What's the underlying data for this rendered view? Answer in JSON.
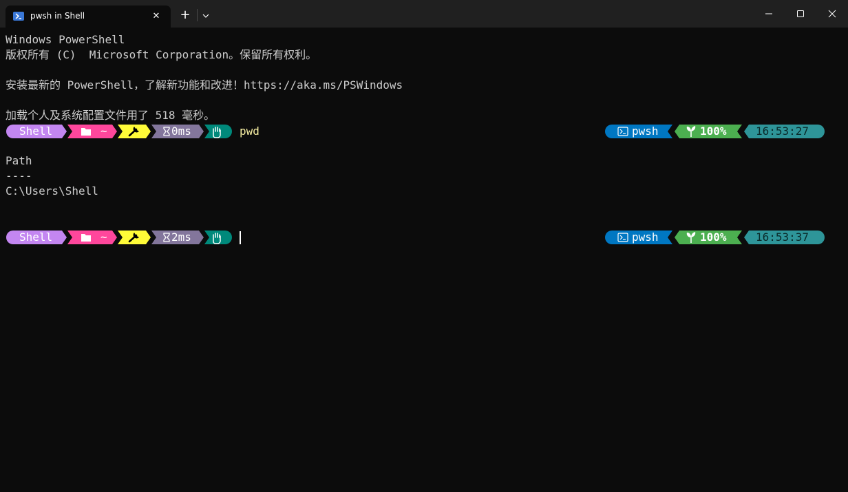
{
  "window": {
    "tab_title": "pwsh in Shell",
    "tab_close_glyph": "✕",
    "new_tab_glyph": "+",
    "icons": {
      "tab": "powershell-icon",
      "dropdown": "chevron-down-icon",
      "minimize": "minimize-icon",
      "maximize": "maximize-icon",
      "close": "close-icon"
    }
  },
  "terminal": {
    "lines": [
      "Windows PowerShell",
      "版权所有 (C)  Microsoft Corporation。保留所有权利。",
      "",
      "安装最新的 PowerShell，了解新功能和改进！https://aka.ms/PSWindows",
      "",
      "加载个人及系统配置文件用了 518 毫秒。"
    ],
    "output_lines": [
      "",
      "Path",
      "----",
      "C:\\Users\\Shell",
      "",
      ""
    ],
    "prompts": [
      {
        "user": "Shell",
        "path": "~",
        "duration": "0ms",
        "command": "pwd",
        "shell": "pwsh",
        "battery": "100%",
        "time": "16:53:27"
      },
      {
        "user": "Shell",
        "path": "~",
        "duration": "2ms",
        "command": "",
        "shell": "pwsh",
        "battery": "100%",
        "time": "16:53:37"
      }
    ],
    "segment_icons": {
      "folder": "folder-icon",
      "git": "wrench-icon",
      "duration": "hourglass-icon",
      "status": "hand-icon",
      "shell": "terminal-icon",
      "battery": "leaf-icon"
    },
    "colors": {
      "background": "#0c0c0c",
      "foreground": "#cccccc",
      "command": "#f9f1a5",
      "user_segment": "#c386f1",
      "path_segment": "#ff479c",
      "git_segment": "#fffb38",
      "duration_segment": "#83769c",
      "status_segment": "#00897b",
      "shell_segment": "#0077c2",
      "battery_segment": "#4caf50",
      "time_segment": "#2e9599"
    }
  }
}
